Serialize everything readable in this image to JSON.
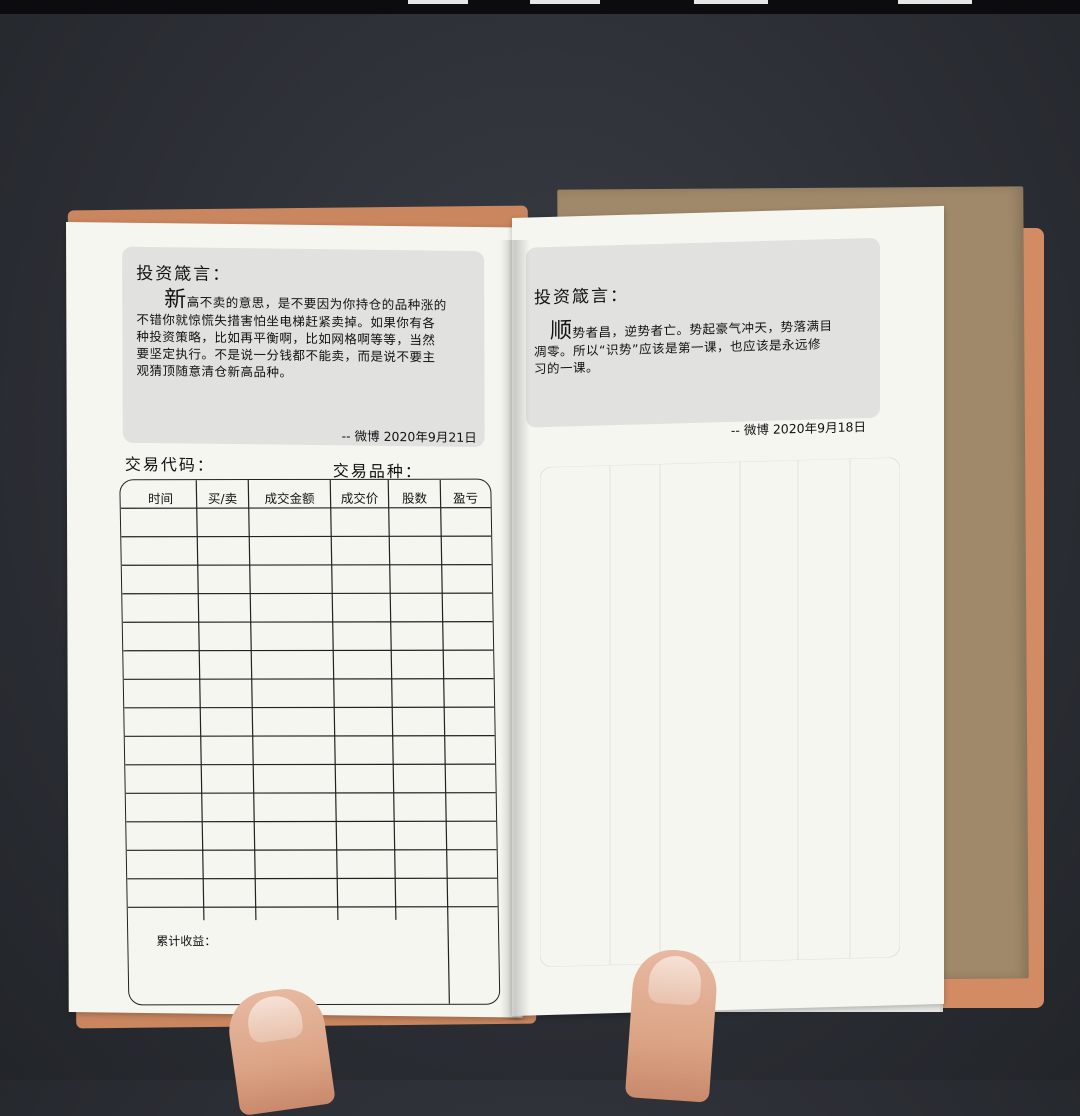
{
  "left_page": {
    "quote_title": "投资箴言：",
    "quote_first_char": "新",
    "quote_lines": [
      "高不卖的意思，是不要因为你持仓的品种涨的",
      "不错你就惊慌失措害怕坐电梯赶紧卖掉。如果你有各",
      "种投资策略，比如再平衡啊，比如网格啊等等，当然",
      "要坚定执行。不是说一分钱都不能卖，而是说不要主",
      "观猜顶随意清仓新高品种。"
    ],
    "signature": "-- 微博 2020年9月21日",
    "code_label": "交易代码：",
    "variety_label": "交易品种：",
    "table_headers": [
      "时间",
      "买/卖",
      "成交金额",
      "成交价",
      "股数",
      "盈亏"
    ],
    "total_label": "累计收益："
  },
  "right_page": {
    "quote_title": "投资箴言：",
    "quote_first_char": "顺",
    "quote_lines": [
      "势者昌，逆势者亡。势起豪气冲天，势落满目",
      "凋零。所以“识势”应该是第一课，也应该是永远修",
      "习的一课。"
    ],
    "signature": "-- 微博 2020年9月18日"
  },
  "colors": {
    "desk": "#2b2e34",
    "leather_cover": "#c9865f",
    "kraft_paper": "#a0896a",
    "page": "#f6f6f1",
    "quote_box": "#e1e2e0"
  }
}
